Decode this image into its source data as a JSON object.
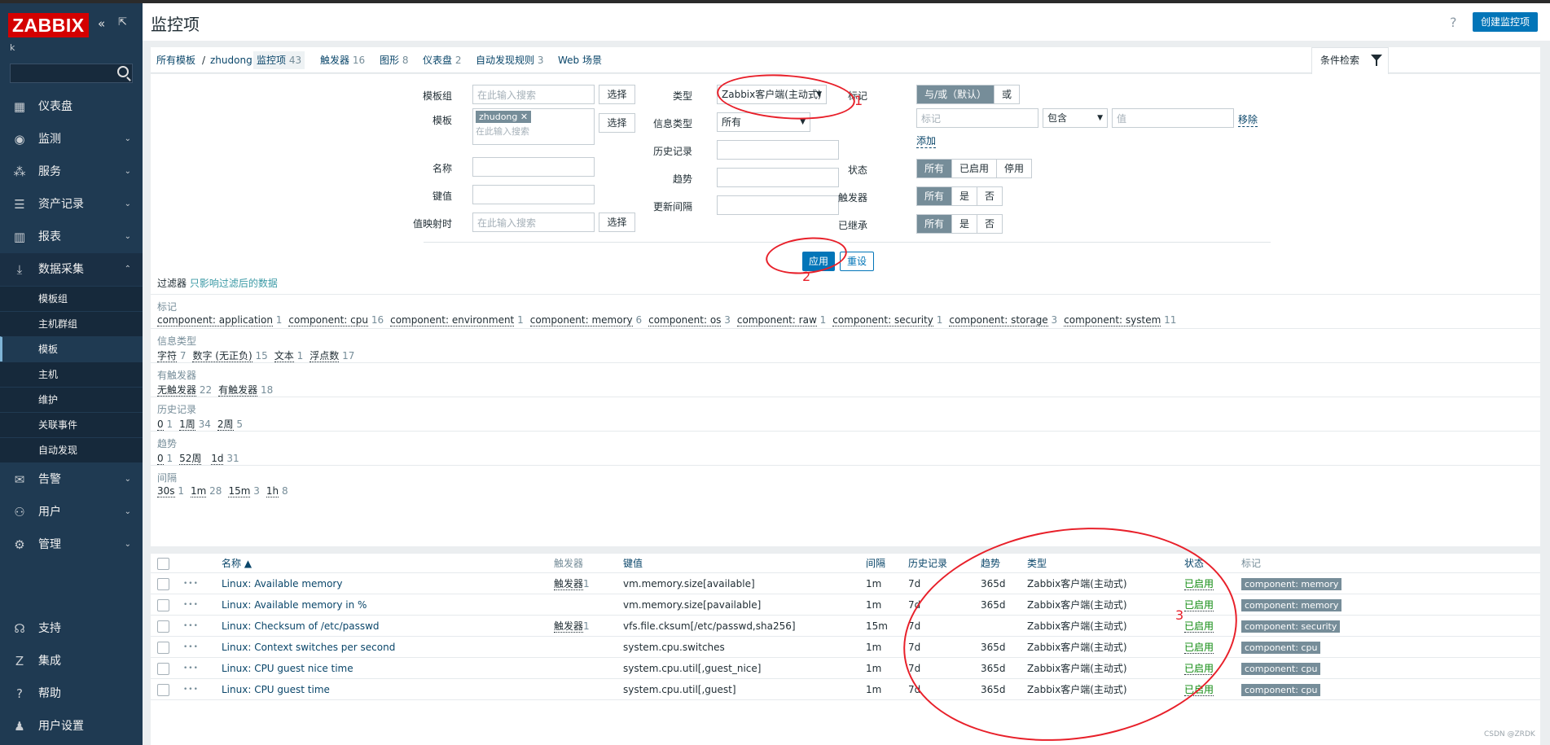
{
  "sidebar": {
    "logo": "ZABBIX",
    "collapse_icon": "«",
    "kiosk_icon": "⇱",
    "user": "k",
    "search_placeholder": "",
    "menu": [
      {
        "label": "仪表盘",
        "icon": "dashboard-icon",
        "glyph": "▦",
        "chevron": ""
      },
      {
        "label": "监测",
        "icon": "eye-icon",
        "glyph": "◉",
        "chevron": "⌄"
      },
      {
        "label": "服务",
        "icon": "services-icon",
        "glyph": "⁂",
        "chevron": "⌄"
      },
      {
        "label": "资产记录",
        "icon": "list-icon",
        "glyph": "☰",
        "chevron": "⌄"
      },
      {
        "label": "报表",
        "icon": "report-icon",
        "glyph": "▥",
        "chevron": "⌄"
      },
      {
        "label": "数据采集",
        "icon": "download-icon",
        "glyph": "⤓",
        "chevron": "⌃"
      }
    ],
    "submenu": [
      "模板组",
      "主机群组",
      "模板",
      "主机",
      "维护",
      "关联事件",
      "自动发现"
    ],
    "submenu_selected": 2,
    "menu2": [
      {
        "label": "告警",
        "icon": "envelope-icon",
        "glyph": "✉",
        "chevron": "⌄"
      },
      {
        "label": "用户",
        "icon": "users-icon",
        "glyph": "⚇",
        "chevron": "⌄"
      },
      {
        "label": "管理",
        "icon": "gear-icon",
        "glyph": "⚙",
        "chevron": "⌄"
      }
    ],
    "bottom": [
      {
        "label": "支持",
        "icon": "headset-icon",
        "glyph": "☊"
      },
      {
        "label": "集成",
        "icon": "integrations-icon",
        "glyph": "Z"
      },
      {
        "label": "帮助",
        "icon": "help-icon",
        "glyph": "?"
      },
      {
        "label": "用户设置",
        "icon": "user-icon",
        "glyph": "♟"
      }
    ]
  },
  "header": {
    "title": "监控项",
    "help": "?",
    "create_button": "创建监控项"
  },
  "tabs": {
    "all_templates": "所有模板",
    "separator": "/",
    "template": "zhudong",
    "items": [
      {
        "label": "监控项",
        "count": "43"
      },
      {
        "label": "触发器",
        "count": "16"
      },
      {
        "label": "图形",
        "count": "8"
      },
      {
        "label": "仪表盘",
        "count": "2"
      },
      {
        "label": "自动发现规则",
        "count": "3"
      },
      {
        "label": "Web 场景",
        "count": ""
      }
    ],
    "filter_tab": "条件检索"
  },
  "filter": {
    "labels": {
      "template_group": "模板组",
      "template": "模板",
      "name": "名称",
      "key": "键值",
      "valuemap": "值映射时",
      "type": "类型",
      "info_type": "信息类型",
      "history": "历史记录",
      "trends": "趋势",
      "interval": "更新间隔",
      "tags": "标记",
      "state": "状态",
      "triggers": "触发器",
      "inherited": "已继承"
    },
    "placeholder": "在此输入搜索",
    "select": "选择",
    "template_chip": "zhudong",
    "chip_remove": "✕",
    "type_value": "Zabbix客户端(主动式)",
    "info_type_value": "所有",
    "tag_mode": [
      "与/或（默认）",
      "或"
    ],
    "tag_placeholder": "标记",
    "tag_op": "包含",
    "tag_value_placeholder": "值",
    "tag_remove": "移除",
    "tag_add": "添加",
    "state_options": [
      "所有",
      "已启用",
      "停用"
    ],
    "trigger_options": [
      "所有",
      "是",
      "否"
    ],
    "inherit_options": [
      "所有",
      "是",
      "否"
    ],
    "apply": "应用",
    "reset": "重设"
  },
  "subfilter": {
    "title": "过滤器",
    "hint": "只影响过滤后的数据",
    "groups": [
      {
        "label": "标记",
        "items": [
          {
            "t": "component: application",
            "n": "1"
          },
          {
            "t": "component: cpu",
            "n": "16"
          },
          {
            "t": "component: environment",
            "n": "1"
          },
          {
            "t": "component: memory",
            "n": "6"
          },
          {
            "t": "component: os",
            "n": "3"
          },
          {
            "t": "component: raw",
            "n": "1"
          },
          {
            "t": "component: security",
            "n": "1"
          },
          {
            "t": "component: storage",
            "n": "3"
          },
          {
            "t": "component: system",
            "n": "11"
          }
        ]
      },
      {
        "label": "信息类型",
        "items": [
          {
            "t": "字符",
            "n": "7"
          },
          {
            "t": "数字 (无正负)",
            "n": "15"
          },
          {
            "t": "文本",
            "n": "1"
          },
          {
            "t": "浮点数",
            "n": "17"
          }
        ]
      },
      {
        "label": "有触发器",
        "items": [
          {
            "t": "无触发器",
            "n": "22"
          },
          {
            "t": "有触发器",
            "n": "18"
          }
        ]
      },
      {
        "label": "历史记录",
        "items": [
          {
            "t": "0",
            "n": "1"
          },
          {
            "t": "1周",
            "n": "34"
          },
          {
            "t": "2周",
            "n": "5"
          }
        ]
      },
      {
        "label": "趋势",
        "items": [
          {
            "t": "0",
            "n": "1"
          },
          {
            "t": "52周",
            "n": ""
          },
          {
            "t": "1d",
            "n": "31"
          }
        ]
      },
      {
        "label": "间隔",
        "items": [
          {
            "t": "30s",
            "n": "1"
          },
          {
            "t": "1m",
            "n": "28"
          },
          {
            "t": "15m",
            "n": "3"
          },
          {
            "t": "1h",
            "n": "8"
          }
        ]
      }
    ]
  },
  "table": {
    "columns": [
      "名称 ▲",
      "触发器",
      "键值",
      "间隔",
      "历史记录",
      "趋势",
      "类型",
      "状态",
      "标记"
    ],
    "rows": [
      {
        "name": "Linux: Available memory",
        "triggers": "触发器",
        "tcount": "1",
        "key": "vm.memory.size[available]",
        "interval": "1m",
        "history": "7d",
        "trends": "365d",
        "type": "Zabbix客户端(主动式)",
        "status": "已启用",
        "tag": "component: memory"
      },
      {
        "name": "Linux: Available memory in %",
        "triggers": "",
        "tcount": "",
        "key": "vm.memory.size[pavailable]",
        "interval": "1m",
        "history": "7d",
        "trends": "365d",
        "type": "Zabbix客户端(主动式)",
        "status": "已启用",
        "tag": "component: memory"
      },
      {
        "name": "Linux: Checksum of /etc/passwd",
        "triggers": "触发器",
        "tcount": "1",
        "key": "vfs.file.cksum[/etc/passwd,sha256]",
        "interval": "15m",
        "history": "7d",
        "trends": "",
        "type": "Zabbix客户端(主动式)",
        "status": "已启用",
        "tag": "component: security"
      },
      {
        "name": "Linux: Context switches per second",
        "triggers": "",
        "tcount": "",
        "key": "system.cpu.switches",
        "interval": "1m",
        "history": "7d",
        "trends": "365d",
        "type": "Zabbix客户端(主动式)",
        "status": "已启用",
        "tag": "component: cpu"
      },
      {
        "name": "Linux: CPU guest nice time",
        "triggers": "",
        "tcount": "",
        "key": "system.cpu.util[,guest_nice]",
        "interval": "1m",
        "history": "7d",
        "trends": "365d",
        "type": "Zabbix客户端(主动式)",
        "status": "已启用",
        "tag": "component: cpu"
      },
      {
        "name": "Linux: CPU guest time",
        "triggers": "",
        "tcount": "",
        "key": "system.cpu.util[,guest]",
        "interval": "1m",
        "history": "7d",
        "trends": "365d",
        "type": "Zabbix客户端(主动式)",
        "status": "已启用",
        "tag": "component: cpu"
      }
    ]
  },
  "annotations": [
    "1",
    "2",
    "3"
  ],
  "watermark": "CSDN @ZRDK",
  "colors": {
    "accent": "#0275b8",
    "sidebar": "#1f3a52",
    "logo": "#d40000",
    "enabled": "#0e8a0e",
    "annotation": "#e8202a",
    "tag": "#768d99"
  }
}
